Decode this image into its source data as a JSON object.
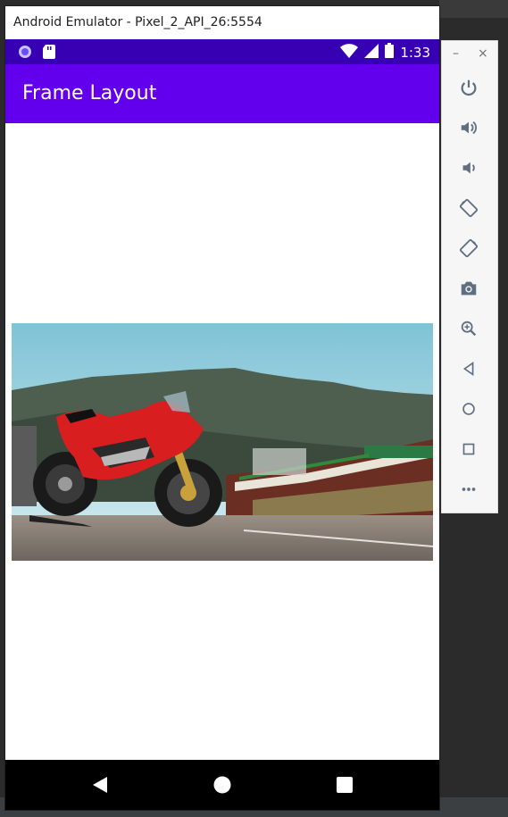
{
  "window": {
    "title": "Android Emulator - Pixel_2_API_26:5554"
  },
  "status_bar": {
    "time": "1:33"
  },
  "app_bar": {
    "title": "Frame Layout"
  },
  "side_panel": {
    "minimize_label": "–",
    "close_label": "×"
  },
  "colors": {
    "status_bar": "#3700b3",
    "app_bar": "#6200ee",
    "panel_icon": "#5f6f7f",
    "motorcycle_red": "#d81e1e"
  },
  "icons": [
    "power-icon",
    "volume-up-icon",
    "volume-down-icon",
    "rotate-left-icon",
    "rotate-right-icon",
    "camera-icon",
    "zoom-icon",
    "back-icon",
    "home-icon",
    "overview-icon",
    "more-icon"
  ]
}
